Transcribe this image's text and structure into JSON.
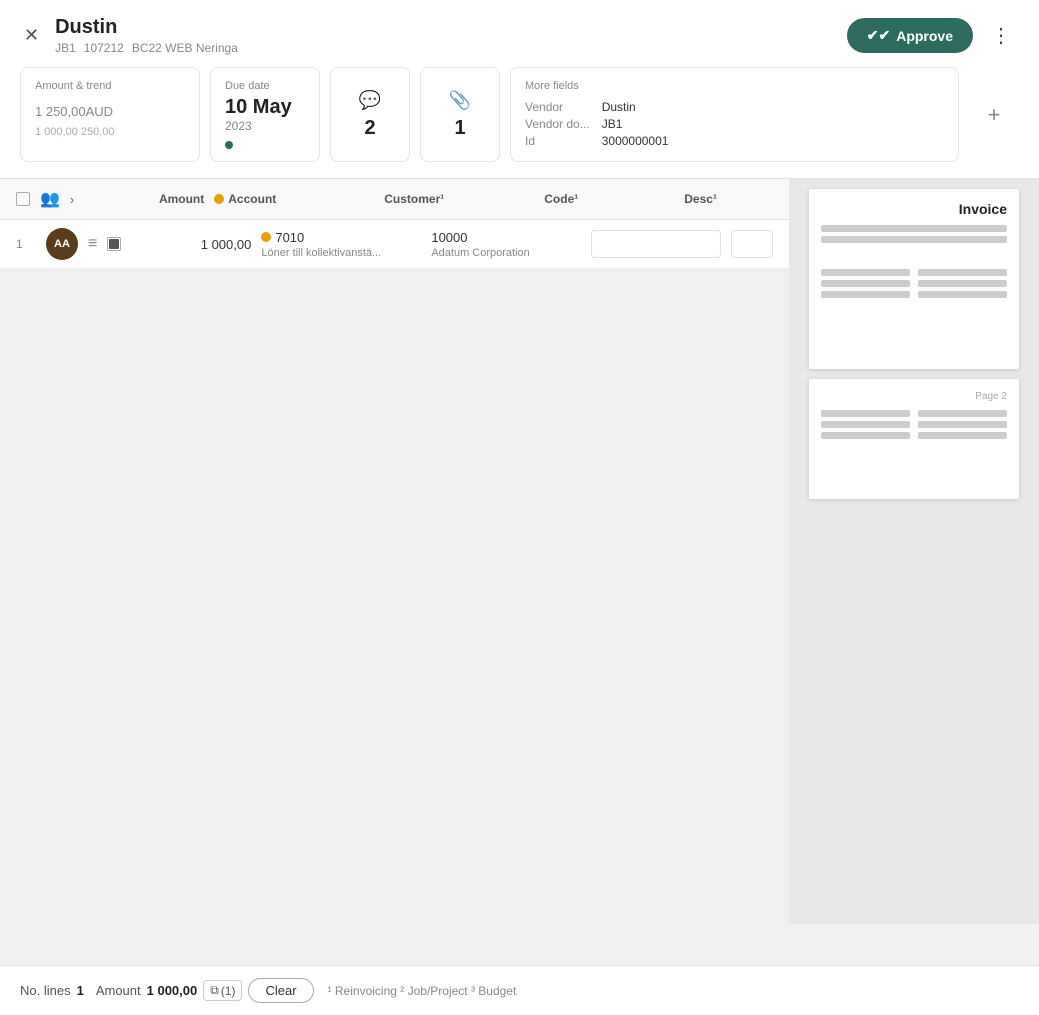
{
  "header": {
    "vendor_name": "Dustin",
    "meta": [
      "JB1",
      "107212",
      "BC22 WEB Neringa"
    ],
    "approve_label": "Approve",
    "more_label": "⋮"
  },
  "cards": {
    "amount_label": "Amount & trend",
    "amount_value": "1 250,00",
    "amount_currency": "AUD",
    "amount_sub": "1 000,00  250,00",
    "due_date_label": "Due date",
    "due_date_main": "10 May",
    "due_date_year": "2023",
    "comments_count": "2",
    "attachments_count": "1",
    "more_fields_label": "More fields",
    "fields": [
      {
        "key": "Vendor",
        "val": "Dustin"
      },
      {
        "key": "Vendor do...",
        "val": "JB1"
      },
      {
        "key": "Id",
        "val": "3000000001"
      }
    ]
  },
  "table": {
    "columns": {
      "amount": "Amount",
      "account": "Account",
      "customer": "Customer¹",
      "code": "Code¹",
      "desc": "Desc¹"
    },
    "rows": [
      {
        "num": "1",
        "avatar": "AA",
        "amount": "1 000,00",
        "account_num": "7010",
        "account_name": "Löner till kollektivanstä...",
        "customer_num": "10000",
        "customer_name": "Adatum Corporation",
        "code": "",
        "desc": ""
      }
    ]
  },
  "footer": {
    "no_lines_label": "No. lines",
    "no_lines_value": "1",
    "amount_label": "Amount",
    "amount_value": "1 000,00",
    "copy_count": "(1)",
    "clear_label": "Clear",
    "footnote": "¹ Reinvoicing  ² Job/Project  ³ Budget"
  },
  "invoice_preview": {
    "title": "Invoice",
    "page2_label": "Page 2"
  }
}
